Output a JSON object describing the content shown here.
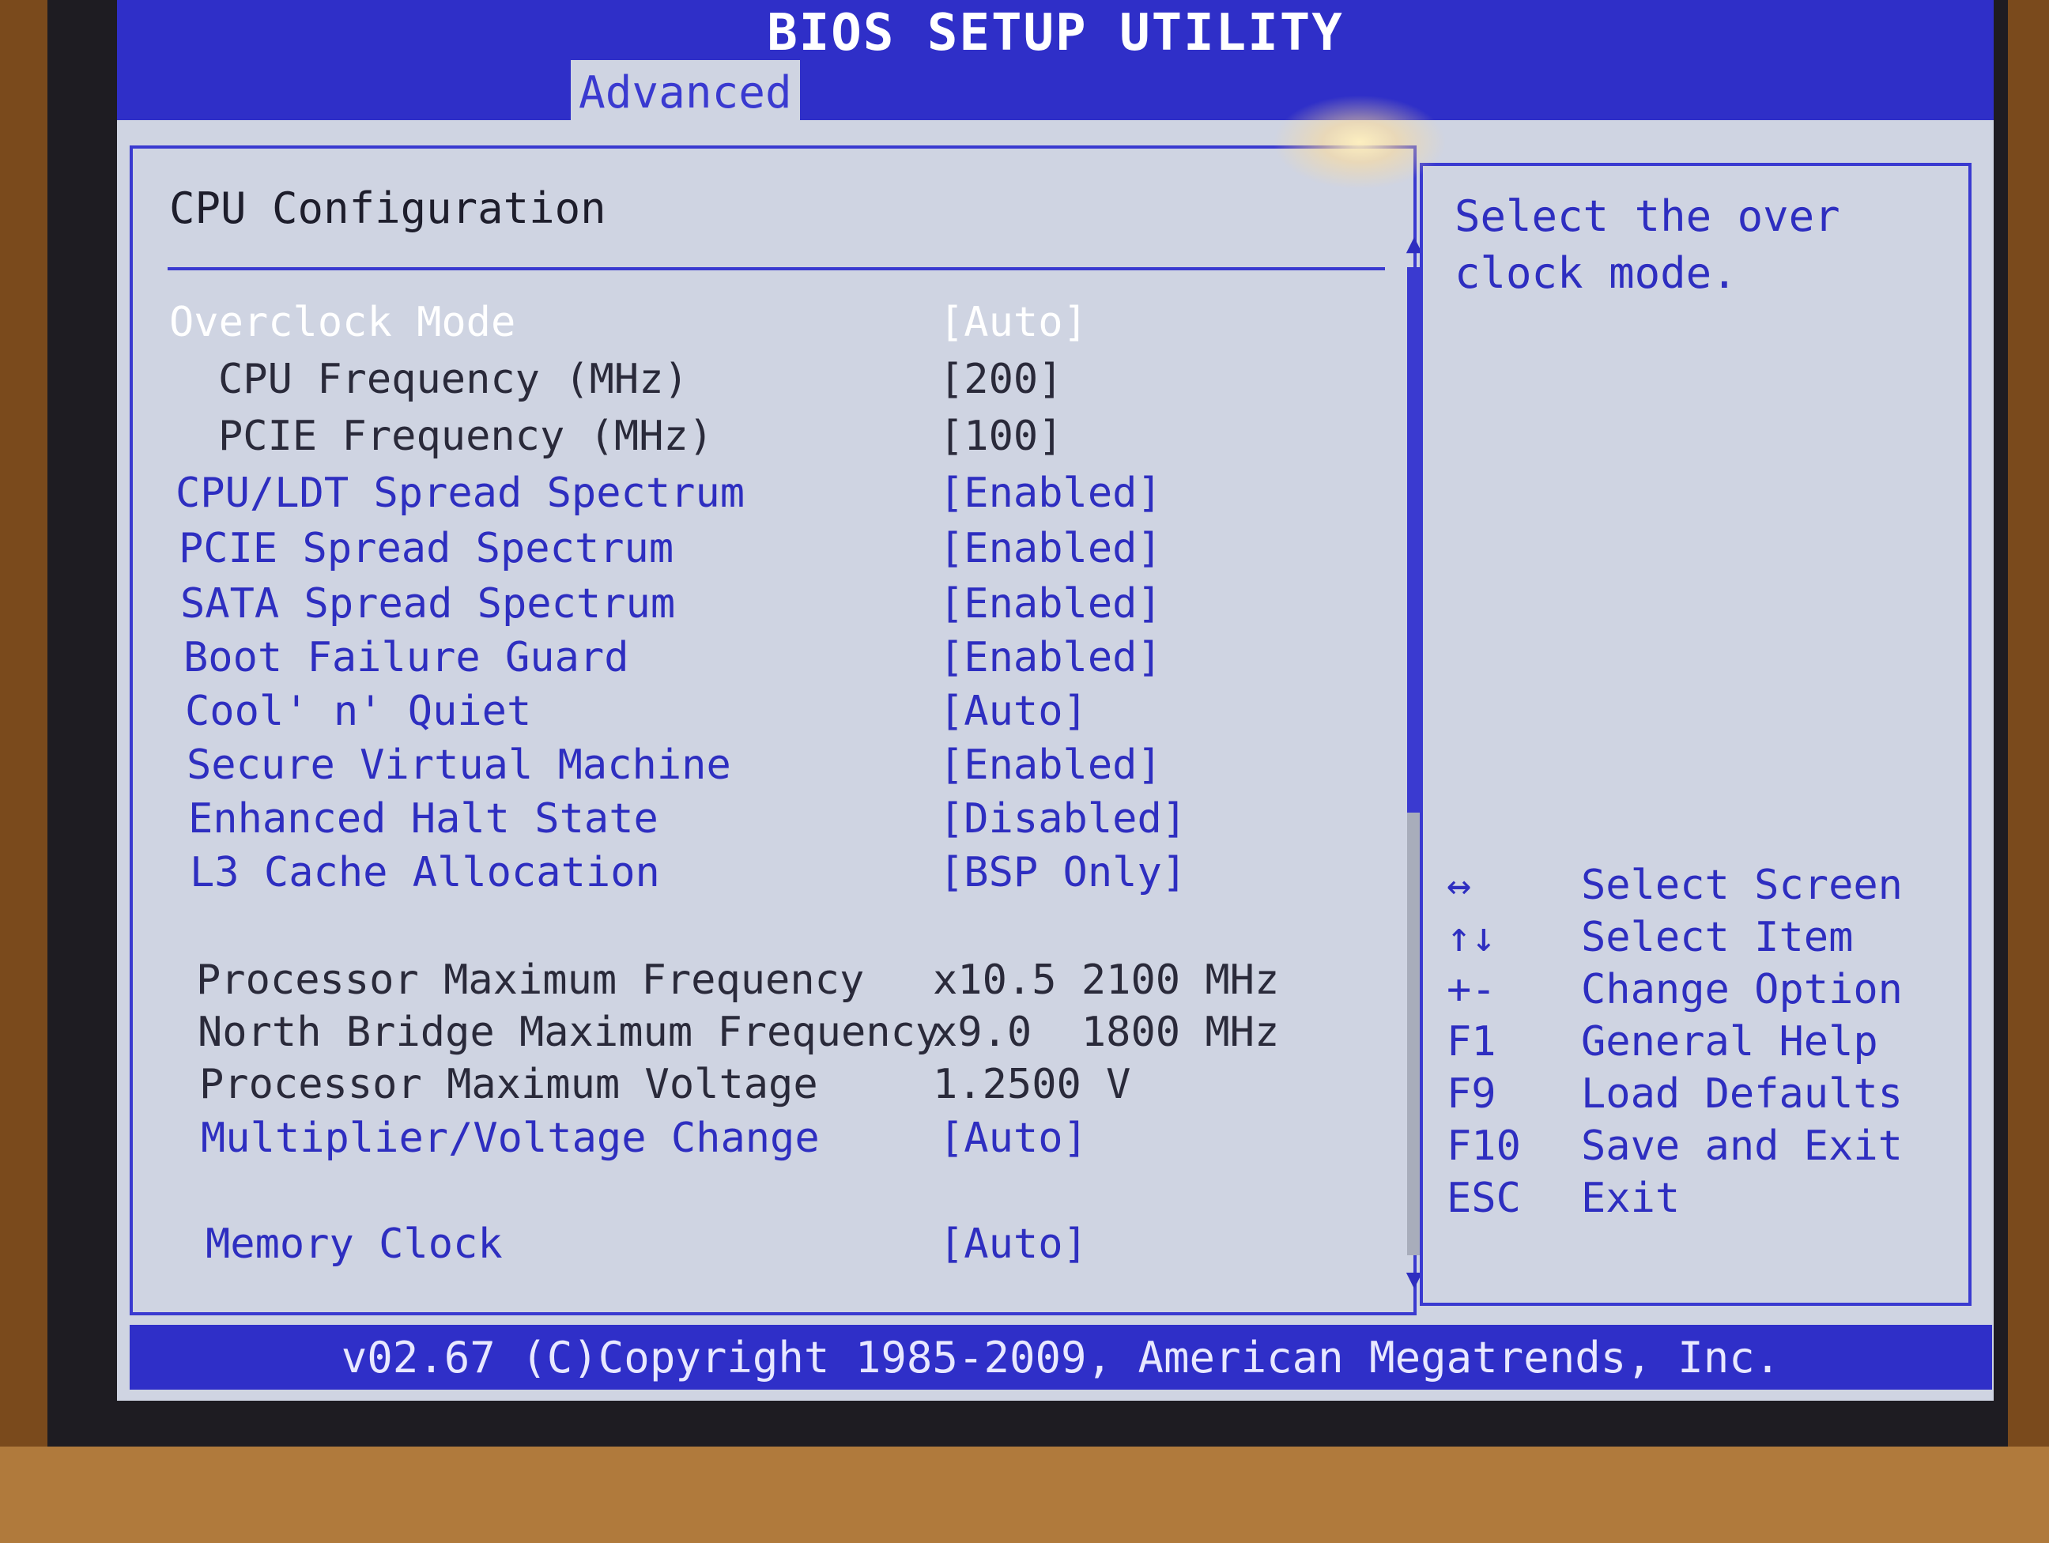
{
  "window": {
    "title": "BIOS SETUP UTILITY"
  },
  "tabs": [
    {
      "label": "Advanced",
      "active": true
    }
  ],
  "section": {
    "title": "CPU Configuration"
  },
  "settings": [
    {
      "label": "Overclock Mode",
      "value": "[Auto]",
      "selected": true
    },
    {
      "label": "CPU Frequency (MHz)",
      "value": "[200]"
    },
    {
      "label": "PCIE Frequency (MHz)",
      "value": "[100]"
    },
    {
      "label": "CPU/LDT Spread Spectrum",
      "value": "[Enabled]"
    },
    {
      "label": "PCIE Spread Spectrum",
      "value": "[Enabled]"
    },
    {
      "label": "SATA Spread Spectrum",
      "value": "[Enabled]"
    },
    {
      "label": "Boot Failure Guard",
      "value": "[Enabled]"
    },
    {
      "label": "Cool' n' Quiet",
      "value": "[Auto]"
    },
    {
      "label": "Secure Virtual Machine",
      "value": "[Enabled]"
    },
    {
      "label": "Enhanced Halt State",
      "value": "[Disabled]"
    },
    {
      "label": "L3 Cache Allocation",
      "value": "[BSP Only]"
    },
    {
      "label": "Processor Maximum Frequency",
      "value": "x10.5 2100 MHz"
    },
    {
      "label": "North Bridge Maximum Frequency",
      "value": "x9.0  1800 MHz"
    },
    {
      "label": "Processor Maximum Voltage",
      "value": "1.2500 V"
    },
    {
      "label": "Multiplier/Voltage Change",
      "value": "[Auto]"
    },
    {
      "label": "Memory Clock",
      "value": "[Auto]"
    }
  ],
  "help": {
    "text": "Select the over clock mode.",
    "keys": [
      {
        "key": "↔",
        "desc": "Select Screen"
      },
      {
        "key": "↑↓",
        "desc": "Select Item"
      },
      {
        "key": "+-",
        "desc": "Change Option"
      },
      {
        "key": "F1",
        "desc": "General Help"
      },
      {
        "key": "F9",
        "desc": "Load Defaults"
      },
      {
        "key": "F10",
        "desc": "Save and Exit"
      },
      {
        "key": "ESC",
        "desc": "Exit"
      }
    ]
  },
  "footer": {
    "text": "v02.67 (C)Copyright 1985-2009, American Megatrends, Inc."
  },
  "colors": {
    "bar_blue": "#2f2fc8",
    "screen_bg": "#cfd4e2",
    "option_blue": "#2e2ec0",
    "selected_white": "#ffffff"
  }
}
